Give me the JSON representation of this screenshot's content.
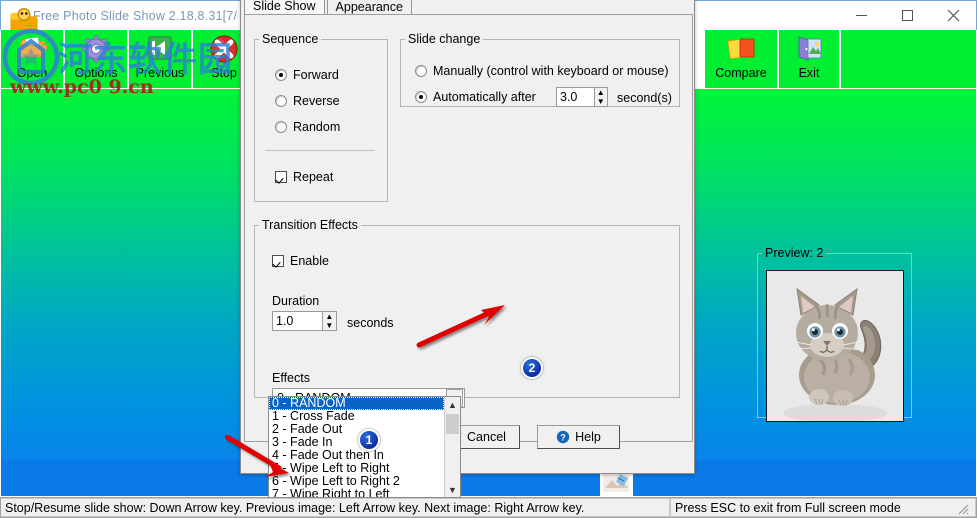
{
  "window": {
    "title": "Free Photo Slide Show 2.18.8.31[7/",
    "icon": "app-icon",
    "minimize": "—",
    "maximize": "☐",
    "close": "✕"
  },
  "toolbar": {
    "buttons": [
      {
        "label": "Open",
        "icon": "open-folder-icon"
      },
      {
        "label": "Options",
        "icon": "gear-icon"
      },
      {
        "label": "Previous",
        "icon": "previous-icon"
      },
      {
        "label": "Stop",
        "icon": "stop-icon"
      },
      {
        "label": "*",
        "icon": "asterisk-icon"
      },
      {
        "label": "Compare",
        "icon": "compare-icon"
      },
      {
        "label": "Exit",
        "icon": "exit-door-icon"
      }
    ]
  },
  "watermark": {
    "cn_text": "河东软件园",
    "url_text": "www.pc0\u0000\u0000.cn",
    "url_display": "www.pc0  9.cn"
  },
  "dialog": {
    "tabs": [
      {
        "label": "Slide Show",
        "active": true
      },
      {
        "label": "Appearance",
        "active": false
      }
    ],
    "sequence": {
      "legend": "Sequence",
      "options": [
        {
          "label": "Forward",
          "selected": true
        },
        {
          "label": "Reverse",
          "selected": false
        },
        {
          "label": "Random",
          "selected": false
        }
      ],
      "repeat": {
        "label": "Repeat",
        "checked": true
      }
    },
    "slide_change": {
      "legend": "Slide change",
      "manual": {
        "label": "Manually (control with keyboard or mouse)",
        "selected": false
      },
      "automatic": {
        "label": "Automatically after",
        "selected": true
      },
      "interval_value": "3.0",
      "units_label": "second(s)"
    },
    "transition": {
      "legend": "Transition Effects",
      "enable": {
        "label": "Enable",
        "checked": true
      },
      "duration_label": "Duration",
      "duration_value": "1.0",
      "duration_units": "seconds",
      "effects_label": "Effects",
      "selected_effect": "0 - RANDOM",
      "effect_options": [
        "0 - RANDOM",
        "1 - Cross Fade",
        "2 - Fade Out",
        "3 - Fade In",
        "4 - Fade Out then In",
        "5 - Wipe Left to Right",
        "6 - Wipe Left to Right 2",
        "7 - Wipe Right to Left"
      ]
    },
    "preview": {
      "legend": "Preview: 2",
      "image_alt": "kitten-photo"
    },
    "buttons": {
      "cancel": "Cancel",
      "help": "Help"
    }
  },
  "annotations": {
    "badge_1": "1",
    "badge_2": "2"
  },
  "statusbar": {
    "left": "Stop/Resume slide show: Down Arrow key. Previous image: Left Arrow key. Next image: Right Arrow key.",
    "right": "Press ESC to exit from Full screen mode"
  },
  "colors": {
    "toolbar_green": "#00ef33",
    "photo_top": "#00f537",
    "photo_bottom": "#0f7cf0",
    "selection_blue": "#0a64c8",
    "arrow_red": "#e00000",
    "badge_blue": "#0a2fa8"
  }
}
